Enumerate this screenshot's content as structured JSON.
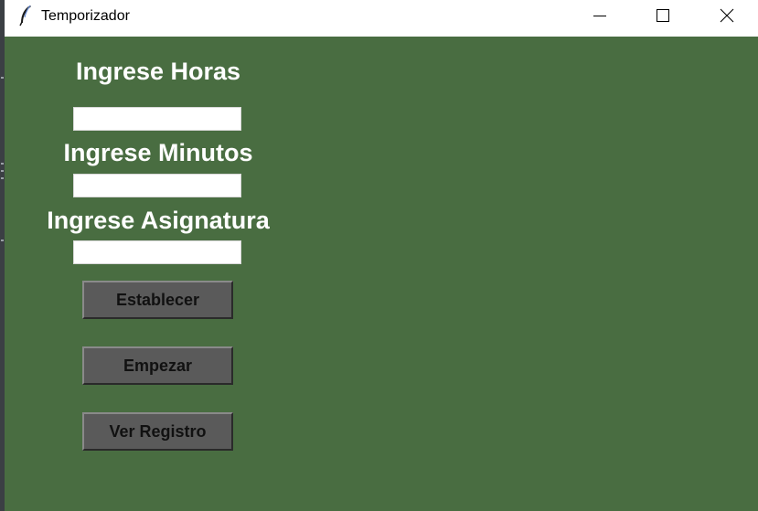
{
  "window": {
    "title": "Temporizador",
    "background_color": "#496d41",
    "controls": {
      "minimize": "minimize-icon",
      "maximize": "maximize-icon",
      "close": "close-icon"
    }
  },
  "form": {
    "hours_label": "Ingrese Horas",
    "hours_value": "",
    "minutes_label": "Ingrese Minutos",
    "minutes_value": "",
    "subject_label": "Ingrese Asignatura",
    "subject_value": ""
  },
  "buttons": {
    "set_label": "Establecer",
    "start_label": "Empezar",
    "log_label": "Ver Registro"
  }
}
